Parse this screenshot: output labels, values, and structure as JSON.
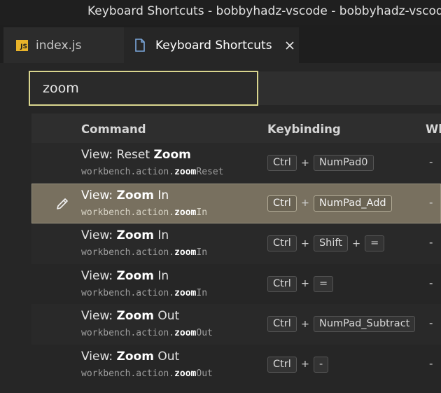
{
  "window": {
    "title": "Keyboard Shortcuts - bobbyhadz-vscode - bobbyhadz-vscod..."
  },
  "tabs": [
    {
      "label": "index.js",
      "icon": "js-file-icon"
    },
    {
      "label": "Keyboard Shortcuts",
      "icon": "document-icon",
      "close": "close-icon"
    }
  ],
  "search": {
    "value": "zoom",
    "placeholder": ""
  },
  "table": {
    "headers": {
      "command": "Command",
      "keybinding": "Keybinding",
      "when": "Wh"
    },
    "rows": [
      {
        "prefix": "View: Reset ",
        "hl": "Zoom",
        "suffix": "",
        "id_prefix": "workbench.action.",
        "id_hl": "zoom",
        "id_suffix": "Reset",
        "keys": [
          "Ctrl",
          "NumPad0"
        ],
        "when": "-"
      },
      {
        "prefix": "View: ",
        "hl": "Zoom",
        "suffix": " In",
        "id_prefix": "workbench.action.",
        "id_hl": "zoom",
        "id_suffix": "In",
        "keys": [
          "Ctrl",
          "NumPad_Add"
        ],
        "when": "-"
      },
      {
        "prefix": "View: ",
        "hl": "Zoom",
        "suffix": " In",
        "id_prefix": "workbench.action.",
        "id_hl": "zoom",
        "id_suffix": "In",
        "keys": [
          "Ctrl",
          "Shift",
          "="
        ],
        "when": "-"
      },
      {
        "prefix": "View: ",
        "hl": "Zoom",
        "suffix": " In",
        "id_prefix": "workbench.action.",
        "id_hl": "zoom",
        "id_suffix": "In",
        "keys": [
          "Ctrl",
          "="
        ],
        "when": "-"
      },
      {
        "prefix": "View: ",
        "hl": "Zoom",
        "suffix": " Out",
        "id_prefix": "workbench.action.",
        "id_hl": "zoom",
        "id_suffix": "Out",
        "keys": [
          "Ctrl",
          "NumPad_Subtract"
        ],
        "when": "-"
      },
      {
        "prefix": "View: ",
        "hl": "Zoom",
        "suffix": " Out",
        "id_prefix": "workbench.action.",
        "id_hl": "zoom",
        "id_suffix": "Out",
        "keys": [
          "Ctrl",
          "-"
        ],
        "when": "-"
      }
    ],
    "plus_sign": "+"
  },
  "colors": {
    "search_border": "#d9d58e",
    "selected_row": "#78705f",
    "js_icon": "#e8b32a",
    "doc_icon": "#7aa6da"
  }
}
